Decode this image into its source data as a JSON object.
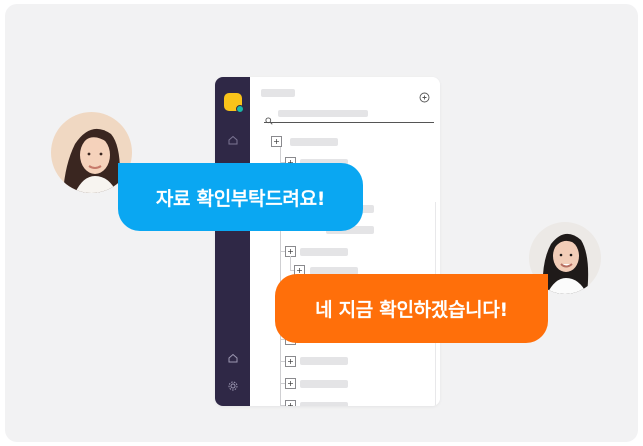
{
  "bubbles": {
    "request": "자료 확인부탁드려요!",
    "reply": "네 지금 확인하겠습니다!"
  },
  "app": {
    "sidebar_icons": [
      "home-icon",
      "home-icon",
      "gear-icon"
    ],
    "tree_expander_symbol": "+"
  },
  "colors": {
    "request_bubble": "#0aa7f2",
    "reply_bubble": "#ff6f0a",
    "sidebar": "#2f2846",
    "logo": "#f9c31a",
    "logo_status": "#19b8a9",
    "card_background": "#f2f2f3"
  }
}
